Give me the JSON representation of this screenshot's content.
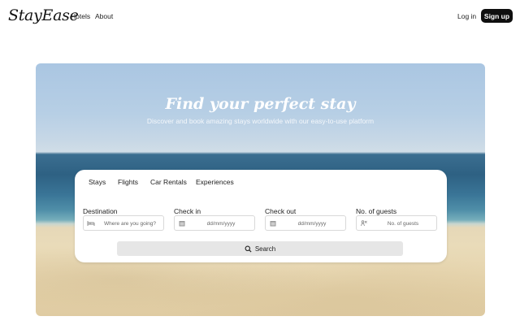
{
  "header": {
    "logo": "StayEase",
    "nav": [
      "Hotels",
      "About"
    ],
    "login_label": "Log in",
    "signup_label": "Sign up"
  },
  "hero": {
    "title": "Find your perfect stay",
    "subtitle": "Discover and book amazing stays worldwide with our easy-to-use platform"
  },
  "search": {
    "tabs": [
      "Stays",
      "Flights",
      "Car Rentals",
      "Experiences"
    ],
    "fields": [
      {
        "label": "Destination",
        "placeholder": "Where are you going?",
        "icon": "bed-icon"
      },
      {
        "label": "Check in",
        "placeholder": "dd/mm/yyyy",
        "icon": "calendar-icon"
      },
      {
        "label": "Check out",
        "placeholder": "dd/mm/yyyy",
        "icon": "calendar-icon"
      },
      {
        "label": "No. of guests",
        "placeholder": "No. of guests",
        "icon": "guests-icon"
      }
    ],
    "button_label": "Search"
  },
  "colors": {
    "signup_bg": "#0f0f0f",
    "search_button_bg": "#e6e6e6",
    "card_bg": "#ffffff"
  }
}
